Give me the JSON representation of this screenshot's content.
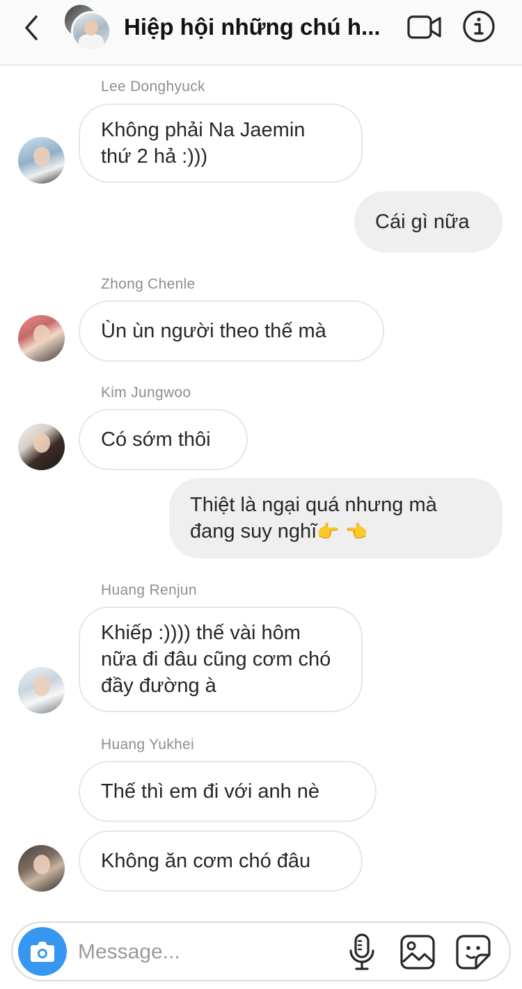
{
  "header": {
    "title": "Hiệp hội những chú h...",
    "icons": {
      "back": "chevron-left-icon",
      "video": "video-camera-icon",
      "info": "info-icon"
    }
  },
  "messages": [
    {
      "sender": "Lee Donghyuck",
      "text": "Không phải Na Jaemin thứ 2 hả :)))",
      "direction": "received"
    },
    {
      "text": "Cái gì nữa",
      "direction": "sent"
    },
    {
      "sender": "Zhong Chenle",
      "text": "Ùn ùn người theo thế mà",
      "direction": "received"
    },
    {
      "sender": "Kim Jungwoo",
      "text": "Có sớm thôi",
      "direction": "received"
    },
    {
      "text": "Thiệt là ngại quá nhưng mà đang suy nghĩ",
      "emoji": "👉 👈",
      "direction": "sent"
    },
    {
      "sender": "Huang Renjun",
      "text": "Khiếp :)))) thế vài hôm nữa đi đâu cũng cơm chó đầy đường à",
      "direction": "received"
    },
    {
      "sender": "Huang Yukhei",
      "text": "Thế thì em đi với anh nè",
      "direction": "received"
    },
    {
      "text": "Không ăn cơm chó đâu",
      "direction": "received"
    }
  ],
  "composer": {
    "placeholder": "Message...",
    "accent": "#3797f0",
    "icons": {
      "camera": "camera-icon",
      "mic": "microphone-icon",
      "gallery": "gallery-icon",
      "sticker": "sticker-icon"
    }
  }
}
